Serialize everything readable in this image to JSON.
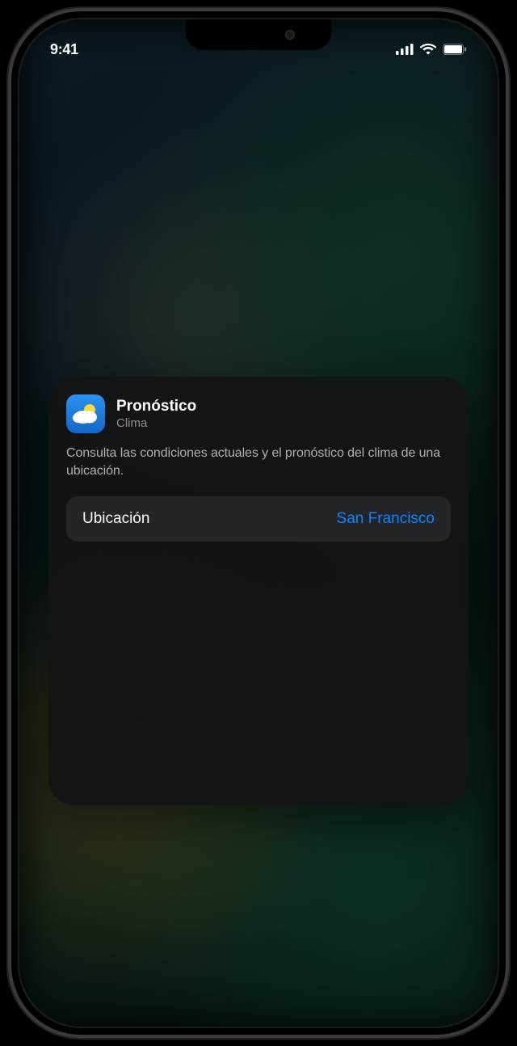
{
  "status_bar": {
    "time": "9:41"
  },
  "widget_config": {
    "title": "Pronóstico",
    "app_name": "Clima",
    "description": "Consulta las condiciones actuales y el pronóstico del clima de una ubicación.",
    "setting_label": "Ubicación",
    "setting_value": "San Francisco",
    "icon_name": "weather-icon"
  },
  "colors": {
    "accent": "#0a84ff",
    "panel_bg": "rgba(20,20,22,0.96)",
    "secondary_text": "#8e8e93",
    "description_text": "#aeaeb2"
  }
}
